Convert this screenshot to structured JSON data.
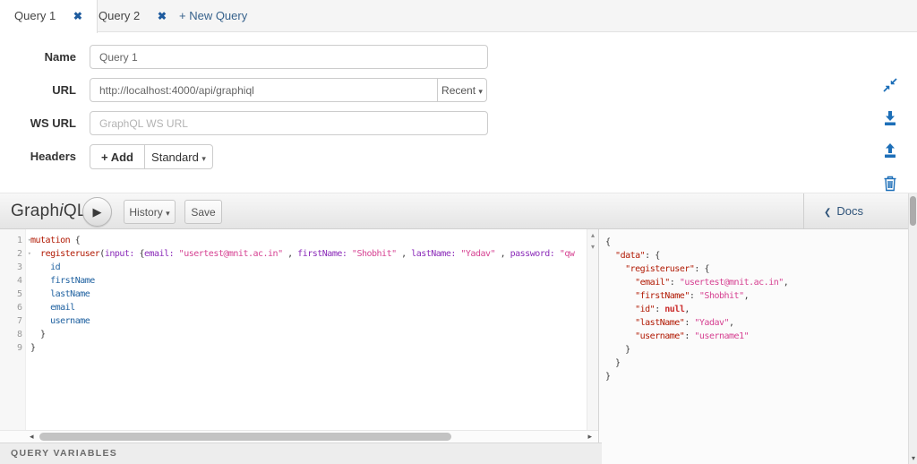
{
  "tabs": {
    "items": [
      {
        "label": "Query 1",
        "active": true
      },
      {
        "label": "Query 2",
        "active": false
      }
    ],
    "new_tab_label": "+ New Query"
  },
  "form": {
    "name_label": "Name",
    "name_value": "Query 1",
    "url_label": "URL",
    "url_value": "http://localhost:4000/api/graphiql",
    "recent_label": "Recent",
    "ws_url_label": "WS URL",
    "ws_url_placeholder": "GraphQL WS URL",
    "headers_label": "Headers",
    "add_label": "+ Add",
    "standard_label": "Standard"
  },
  "side_icons": [
    "collapse-icon",
    "download-icon",
    "upload-icon",
    "trash-icon"
  ],
  "toolbar": {
    "logo_graph": "Graph",
    "logo_i": "i",
    "logo_ql": "QL",
    "history_label": "History",
    "save_label": "Save",
    "docs_label": "Docs"
  },
  "icons": {
    "close": "✖",
    "caret_down": "▾",
    "play": "▶",
    "chevron_left": "❮",
    "scroll_up": "▴",
    "scroll_down": "▾",
    "scroll_left": "◂",
    "scroll_right": "▸",
    "fold_caret": "▾"
  },
  "colors": {
    "accent_blue": "#1d6fb8",
    "tab_close_blue": "#1e5b9e",
    "keyword_red": "#B11A04",
    "property_blue": "#1F61A0",
    "attribute_purple": "#8B2BB9",
    "string_pink": "#D64292",
    "null_red": "#CB2D2D"
  },
  "editor": {
    "gutter": [
      {
        "n": "1",
        "fold": true
      },
      {
        "n": "2",
        "fold": true
      },
      {
        "n": "3"
      },
      {
        "n": "4"
      },
      {
        "n": "5"
      },
      {
        "n": "6"
      },
      {
        "n": "7"
      },
      {
        "n": "8"
      },
      {
        "n": "9"
      }
    ],
    "lines": [
      [
        {
          "t": "mutation ",
          "c": "kw"
        },
        {
          "t": "{",
          "c": "punc"
        }
      ],
      [
        {
          "t": "  ",
          "c": "punc"
        },
        {
          "t": "registeruser",
          "c": "kw"
        },
        {
          "t": "(",
          "c": "punc"
        },
        {
          "t": "input:",
          "c": "attr"
        },
        {
          "t": " ",
          "c": "punc"
        },
        {
          "t": "{",
          "c": "punc"
        },
        {
          "t": "email:",
          "c": "attr"
        },
        {
          "t": " ",
          "c": "punc"
        },
        {
          "t": "\"usertest@mnit.ac.in\"",
          "c": "str"
        },
        {
          "t": " , ",
          "c": "punc"
        },
        {
          "t": "firstName:",
          "c": "attr"
        },
        {
          "t": " ",
          "c": "punc"
        },
        {
          "t": "\"Shobhit\"",
          "c": "str"
        },
        {
          "t": " , ",
          "c": "punc"
        },
        {
          "t": "lastName:",
          "c": "attr"
        },
        {
          "t": " ",
          "c": "punc"
        },
        {
          "t": "\"Yadav\"",
          "c": "str"
        },
        {
          "t": " , ",
          "c": "punc"
        },
        {
          "t": "password:",
          "c": "attr"
        },
        {
          "t": " ",
          "c": "punc"
        },
        {
          "t": "\"qw",
          "c": "str"
        }
      ],
      [
        {
          "t": "    ",
          "c": "punc"
        },
        {
          "t": "id",
          "c": "prop"
        }
      ],
      [
        {
          "t": "    ",
          "c": "punc"
        },
        {
          "t": "firstName",
          "c": "prop"
        }
      ],
      [
        {
          "t": "    ",
          "c": "punc"
        },
        {
          "t": "lastName",
          "c": "prop"
        }
      ],
      [
        {
          "t": "    ",
          "c": "punc"
        },
        {
          "t": "email",
          "c": "prop"
        }
      ],
      [
        {
          "t": "    ",
          "c": "punc"
        },
        {
          "t": "username",
          "c": "prop"
        }
      ],
      [
        {
          "t": "  }",
          "c": "punc"
        }
      ],
      [
        {
          "t": "}",
          "c": "punc"
        }
      ]
    ]
  },
  "result": {
    "lines": [
      [
        {
          "t": "{",
          "c": "punc"
        }
      ],
      [
        {
          "t": "  ",
          "c": "punc"
        },
        {
          "t": "\"data\"",
          "c": "key"
        },
        {
          "t": ": ",
          "c": "punc"
        },
        {
          "t": "{",
          "c": "punc"
        }
      ],
      [
        {
          "t": "    ",
          "c": "punc"
        },
        {
          "t": "\"registeruser\"",
          "c": "key"
        },
        {
          "t": ": ",
          "c": "punc"
        },
        {
          "t": "{",
          "c": "punc"
        }
      ],
      [
        {
          "t": "      ",
          "c": "punc"
        },
        {
          "t": "\"email\"",
          "c": "key"
        },
        {
          "t": ": ",
          "c": "punc"
        },
        {
          "t": "\"usertest@mnit.ac.in\"",
          "c": "str"
        },
        {
          "t": ",",
          "c": "punc"
        }
      ],
      [
        {
          "t": "      ",
          "c": "punc"
        },
        {
          "t": "\"firstName\"",
          "c": "key"
        },
        {
          "t": ": ",
          "c": "punc"
        },
        {
          "t": "\"Shobhit\"",
          "c": "str"
        },
        {
          "t": ",",
          "c": "punc"
        }
      ],
      [
        {
          "t": "      ",
          "c": "punc"
        },
        {
          "t": "\"id\"",
          "c": "key"
        },
        {
          "t": ": ",
          "c": "punc"
        },
        {
          "t": "null",
          "c": "null"
        },
        {
          "t": ",",
          "c": "punc"
        }
      ],
      [
        {
          "t": "      ",
          "c": "punc"
        },
        {
          "t": "\"lastName\"",
          "c": "key"
        },
        {
          "t": ": ",
          "c": "punc"
        },
        {
          "t": "\"Yadav\"",
          "c": "str"
        },
        {
          "t": ",",
          "c": "punc"
        }
      ],
      [
        {
          "t": "      ",
          "c": "punc"
        },
        {
          "t": "\"username\"",
          "c": "key"
        },
        {
          "t": ": ",
          "c": "punc"
        },
        {
          "t": "\"username1\"",
          "c": "str"
        }
      ],
      [
        {
          "t": "    }",
          "c": "punc"
        }
      ],
      [
        {
          "t": "  }",
          "c": "punc"
        }
      ],
      [
        {
          "t": "}",
          "c": "punc"
        }
      ]
    ]
  },
  "footer": {
    "variables_label": "QUERY VARIABLES"
  }
}
